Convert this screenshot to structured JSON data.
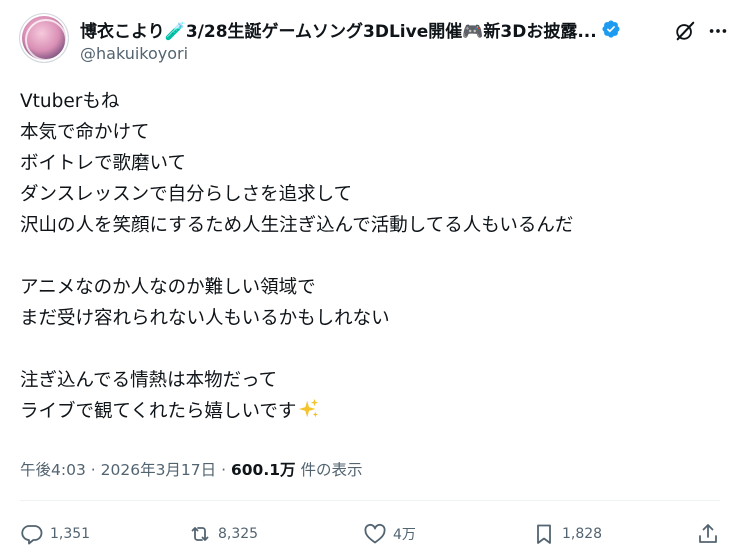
{
  "tweet": {
    "display_name": "博衣こより🧪3/28生誕ゲームソング3DLive開催🎮新3Dお披露...",
    "handle": "@hakuikoyori",
    "lines": [
      "Vtuberもね",
      "本気で命かけて",
      "ボイトレで歌磨いて",
      "ダンスレッスンで自分らしさを追求して",
      "沢山の人を笑顔にするため人生注ぎ込んで活動してる人もいるんだ",
      "",
      "アニメなのか人なのか難しい領域で",
      "まだ受け容れられない人もいるかもしれない",
      "",
      "注ぎ込んでる情熱は本物だって",
      "ライブで観てくれたら嬉しいです"
    ],
    "time": "午後4:03",
    "date": "2026年3月17日",
    "views_count": "600.1万",
    "views_label": "件の表示",
    "separator": "·"
  },
  "actions": {
    "replies": "1,351",
    "reposts": "8,325",
    "likes": "4万",
    "bookmarks": "1,828"
  },
  "icons": {
    "verified": "verified-badge-icon",
    "grok": "grok-icon",
    "more": "more-icon",
    "reply": "reply-icon",
    "repost": "repost-icon",
    "like": "heart-icon",
    "bookmark": "bookmark-icon",
    "share": "share-icon",
    "sparkle": "sparkles-emoji"
  },
  "colors": {
    "verified": "#1d9bf0",
    "text": "#0f1419",
    "muted": "#536471",
    "sparkle": "#f5c32c"
  }
}
